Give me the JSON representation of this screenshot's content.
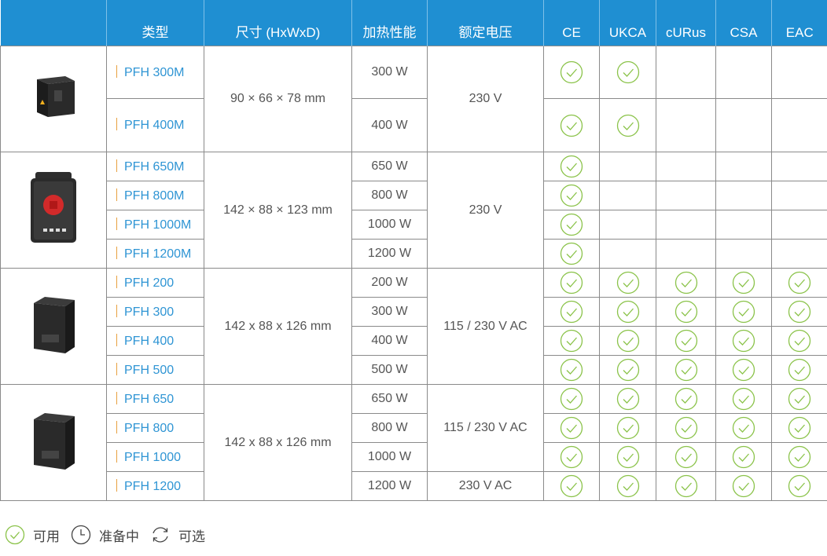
{
  "headers": {
    "image": "",
    "type": "类型",
    "size": "尺寸 (HxWxD)",
    "power": "加热性能",
    "voltage": "额定电压",
    "ce": "CE",
    "ukca": "UKCA",
    "curus": "cURus",
    "csa": "CSA",
    "eac": "EAC"
  },
  "groups": [
    {
      "image_icon": "small-heater-image",
      "size": "90 × 66 × 78 mm",
      "rows": [
        {
          "model": "PFH 300M",
          "power": "300 W",
          "ce": true,
          "ukca": true,
          "curus": false,
          "csa": false,
          "eac": false
        },
        {
          "model": "PFH 400M",
          "power": "400 W",
          "ce": true,
          "ukca": true,
          "curus": false,
          "csa": false,
          "eac": false
        }
      ],
      "voltage": "230 V"
    },
    {
      "image_icon": "fan-heater-image",
      "size": "142 × 88 × 123 mm",
      "rows": [
        {
          "model": "PFH 650M",
          "power": "650 W",
          "ce": true,
          "ukca": false,
          "curus": false,
          "csa": false,
          "eac": false
        },
        {
          "model": "PFH 800M",
          "power": "800 W",
          "ce": true,
          "ukca": false,
          "curus": false,
          "csa": false,
          "eac": false
        },
        {
          "model": "PFH 1000M",
          "power": "1000 W",
          "ce": true,
          "ukca": false,
          "curus": false,
          "csa": false,
          "eac": false
        },
        {
          "model": "PFH 1200M",
          "power": "1200 W",
          "ce": true,
          "ukca": false,
          "curus": false,
          "csa": false,
          "eac": false
        }
      ],
      "voltage": "230 V"
    },
    {
      "image_icon": "heater-image",
      "size": "142 x 88 x 126 mm",
      "rows": [
        {
          "model": "PFH 200",
          "power": "200 W",
          "ce": true,
          "ukca": true,
          "curus": true,
          "csa": true,
          "eac": true
        },
        {
          "model": "PFH 300",
          "power": "300 W",
          "ce": true,
          "ukca": true,
          "curus": true,
          "csa": true,
          "eac": true
        },
        {
          "model": "PFH 400",
          "power": "400 W",
          "ce": true,
          "ukca": true,
          "curus": true,
          "csa": true,
          "eac": true
        },
        {
          "model": "PFH 500",
          "power": "500 W",
          "ce": true,
          "ukca": true,
          "curus": true,
          "csa": true,
          "eac": true
        }
      ],
      "voltage": "115 / 230 V AC"
    },
    {
      "image_icon": "heater-image",
      "size": "142 x 88 x 126 mm",
      "rows": [
        {
          "model": "PFH 650",
          "power": "650 W",
          "ce": true,
          "ukca": true,
          "curus": true,
          "csa": true,
          "eac": true
        },
        {
          "model": "PFH 800",
          "power": "800 W",
          "ce": true,
          "ukca": true,
          "curus": true,
          "csa": true,
          "eac": true
        },
        {
          "model": "PFH 1000",
          "power": "1000 W",
          "ce": true,
          "ukca": true,
          "curus": true,
          "csa": true,
          "eac": true
        },
        {
          "model": "PFH 1200",
          "power": "1200 W",
          "ce": true,
          "ukca": true,
          "curus": true,
          "csa": true,
          "eac": true
        }
      ],
      "voltage": "115 / 230 V AC",
      "voltage_last": "230 V AC"
    }
  ],
  "legend": {
    "available": "可用",
    "in_preparation": "准备中",
    "optional": "可选"
  },
  "colors": {
    "header_bg": "#1f8fd2",
    "model_text": "#2f95d4",
    "model_bar": "#e8a040",
    "check": "#8bc34a"
  }
}
